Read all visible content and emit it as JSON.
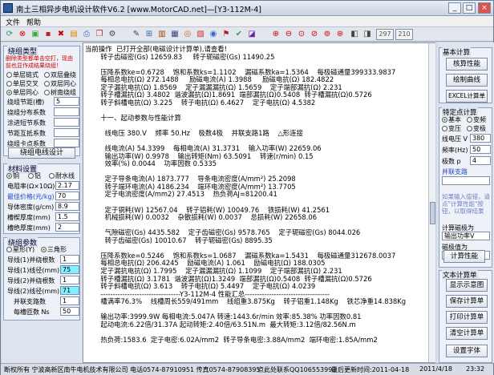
{
  "window": {
    "title": "南土三相异步电机设计软件V6.2  [www.MotorCAD.net]—[Y3-112M-4]"
  },
  "menu": [
    "文件",
    "帮助"
  ],
  "toolbar": {
    "box1": "297",
    "box2": "210"
  },
  "left": {
    "winding_type": {
      "title": "绕组类型",
      "hint_lines": [
        "删除类型都单击空打，现由",
        "前也显作成结果绕组！"
      ],
      "options": [
        [
          "单层链式",
          "双层叠绕"
        ],
        [
          "单层交叉",
          "双层同心"
        ],
        [
          "单层同心",
          "树南绕组"
        ]
      ],
      "selected": "单层同心"
    },
    "pitch": [
      {
        "label": "绕组节距(槽)",
        "value": "5"
      },
      {
        "label": "绕组分布系数",
        "value": ""
      },
      {
        "label": "涂进短节系数",
        "value": ""
      },
      {
        "label": "节距互抵系数",
        "value": ""
      },
      {
        "label": "绕组卡点系数",
        "value": ""
      }
    ],
    "coil_button": "绕组电线设计",
    "material": {
      "title": "材料设置",
      "options": [
        "铜",
        "铝",
        "耐水线"
      ],
      "selected": "铜",
      "rows": [
        {
          "label": "电阻率(Ω×10Ω)",
          "value": "2.17"
        },
        {
          "label": "最佳价格(元/kg)",
          "value": "70"
        },
        {
          "label": "导体密度(g/cm)",
          "value": "8.9"
        },
        {
          "label": "槽楔厚度(mm)",
          "value": "1.5"
        },
        {
          "label": "槽绝厚度(mm)",
          "value": "2"
        }
      ]
    },
    "wire": {
      "title": "绕组参数",
      "options": [
        "星形(Y)",
        "三角形"
      ],
      "selected": "三角形",
      "rows": [
        {
          "label": "导线(1)并绕根数",
          "value": "1"
        },
        {
          "label": "导线(1)线径(mm)",
          "value": "75"
        },
        {
          "label": "导线(2)并绕根数",
          "value": "1"
        },
        {
          "label": "导线(2)线径(mm)",
          "value": "71"
        },
        {
          "label": "并联支路数",
          "value": "1"
        },
        {
          "label": "每槽匝数 Ns",
          "value": "50"
        }
      ]
    }
  },
  "report": [
    {
      "t": "当前操作  已打开全部(电磁设计计算单),请查看!"
    },
    {
      "t": "  转子齿磁密(Gs) 12659.83     转子轭磁密(Gs) 11490.25"
    },
    {
      "t": ""
    },
    {
      "t": "  压降系数ke=0.6728    饱和系数ks=1.1102    漏磁系数ka=1.5364    每极磁通量399333.9837"
    },
    {
      "t": "  每相总电抗(Ω) 272.1488     励磁电流(A) 1.3988     励磁电抗(Ω) 182.4822"
    },
    {
      "t": "  定子漏抗电抗(Ω) 1.8569    定子漏漏漏抗(Ω) 1.5659    定子端部漏抗(Ω) 2.231"
    },
    {
      "t": "  转子槽漏抗(Ω) 3.4802  谐波漏抗(Ω)1.8691  端部漏抗(Ω)0.5408  转子槽漏抗(Ω)0.5726"
    },
    {
      "t": "  转子斜槽电抗(Ω) 3.225    转子电抗(Ω) 6.4627    定子电抗(Ω) 4.5382"
    },
    {
      "t": ""
    },
    {
      "t": "  十一、起动参数与性能计算"
    },
    {
      "t": ""
    },
    {
      "t": "    线电压 380.V    频率 50.Hz    极数4极    并联支路1路    △形连接"
    },
    {
      "t": ""
    },
    {
      "t": "    线电流(A) 54.3399    每相电流(A) 31.3731    输入功率(W) 22659.06"
    },
    {
      "t": "    输出功率(W) 0.9978    输出转矩(Nm) 63.5091    转速(r/min) 0.15"
    },
    {
      "t": "    效率(%) 0.0044    功率因数 0.5335"
    },
    {
      "t": ""
    },
    {
      "t": "    定子导条电流(A) 1873.777    导条电流密度(A/mm²) 25.2098"
    },
    {
      "t": "    转子端环电流(A) 4186.234    端环电流密度(A/mm²) 13.7705"
    },
    {
      "t": "    定子电流密度(A/mm2) 27.4513    热负荷AJ=81200.41"
    },
    {
      "t": ""
    },
    {
      "t": "    定子铜耗(W) 12567.04    转子铝耗(W) 10049.76    铁损耗(W) 41.2561"
    },
    {
      "t": "    机械损耗(W) 0.0032    杂散损耗(W) 0.0037    总损耗(W) 22658.06"
    },
    {
      "t": ""
    },
    {
      "t": "    气隙磁密(Gs) 4435.582    定子齿磁密(Gs) 9578.765    定子轭磁密(Gs) 8044.026"
    },
    {
      "t": "    转子齿磁密(Gs) 10010.67    转子轭磁密(Gs) 8895.35"
    },
    {
      "t": ""
    },
    {
      "t": "  压降系数ke=0.5246    饱和系数ks=1.0687    漏磁系数ka=1.5431    每极磁通量312678.0037"
    },
    {
      "t": "  每相总电抗(Ω) 206.4245    励磁电流(A) 1.061    励磁电抗(Ω) 188.0305"
    },
    {
      "t": "  定子漏抗电抗(Ω) 1.7995    定子漏漏漏抗(Ω) 1.1099    定子端部漏抗(Ω) 2.231"
    },
    {
      "t": "  转子槽漏抗(Ω) 3.1781  谐波漏抗(Ω)1.3249  端部漏抗(Ω)0.5408  转子槽漏抗(Ω)0.5726"
    },
    {
      "t": "  转子斜槽电抗(Ω) 3.613    转子电抗(Ω) 5.4497    定子电抗(Ω) 4.0239"
    },
    {
      "t": "  ---------------------------------Y3-112M-4 性能汇总-----------------------------------"
    },
    {
      "t": "  槽满率76.3%    线槽周长559/491mm    线组重3.875Kg    转子铝重1.148Kg    铁芯净重14.838Kg"
    },
    {
      "t": ""
    },
    {
      "t": "  输出功率:3999.9W 每相电流:5.047A 转速:1443.6r/min 效率:85.38% 功率因数0.81"
    },
    {
      "t": "  起动电流:6.22倍/31.37A 起动转矩:2.40倍/63.51N.m  最大转矩:3.12倍/82.56N.m"
    },
    {
      "t": ""
    },
    {
      "t": "  热负荷:1583.6  定子电密:6.02A/mm2  转子导条电密:3.88A/mm2  端环电密:1.85A/mm2"
    }
  ],
  "right": {
    "basic_title": "基本计算",
    "basic_buttons": [
      "核算性能",
      "绘制曲线",
      "EXCEL计算单"
    ],
    "special_title": "特定点计算",
    "mode_options": [
      [
        "基本",
        "变频"
      ],
      [
        "变压",
        "变极"
      ]
    ],
    "mode_selected": "基本",
    "fields": [
      {
        "label": "线电压 V",
        "value": "380"
      },
      {
        "label": "频率(Hz)",
        "value": "50"
      },
      {
        "label": "极数 p",
        "value": "4"
      }
    ],
    "connection_label": "并联支路",
    "hint": "如果输入值错，请点\"计算性能\"按钮，以取得结果",
    "calc_label": "计算磁极为",
    "calc_select": "输出功率V",
    "poles_label": "磁极值为",
    "poles_value": "",
    "calc_button": "计算性能",
    "doc_title": "文本计算单",
    "doc_buttons": [
      "显示示意图",
      "保存计算单",
      "打印计算单",
      "清空计算单",
      "设置字体"
    ]
  },
  "status": {
    "company": "断权所有  宁波高新区南牛电机技术有限公司 电话0574-87910951 传真0574-87908395",
    "qq": "点此处联系QQ106553993",
    "update": "最后更新时间:2011-04-18",
    "date": "2011/4/18",
    "time": "23:32"
  }
}
